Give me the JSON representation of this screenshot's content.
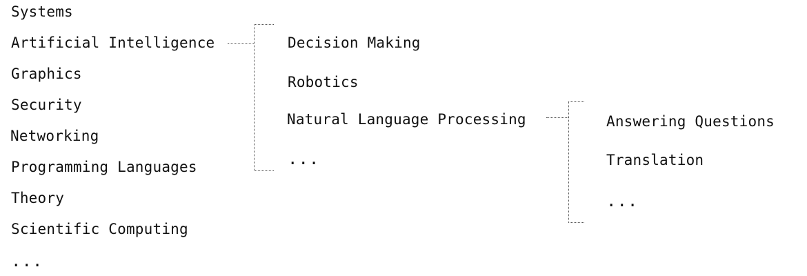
{
  "level1": [
    "Systems",
    "Artificial Intelligence",
    "Graphics",
    "Security",
    "Networking",
    "Programming Languages",
    "Theory",
    "Scientific Computing",
    "..."
  ],
  "level2": [
    "Decision Making",
    "Robotics",
    "Natural Language Processing",
    "..."
  ],
  "level3": [
    "Answering Questions",
    "Translation",
    "..."
  ],
  "style": {
    "text_color": "#111111",
    "connector_color": "#555555",
    "background": "#ffffff"
  }
}
